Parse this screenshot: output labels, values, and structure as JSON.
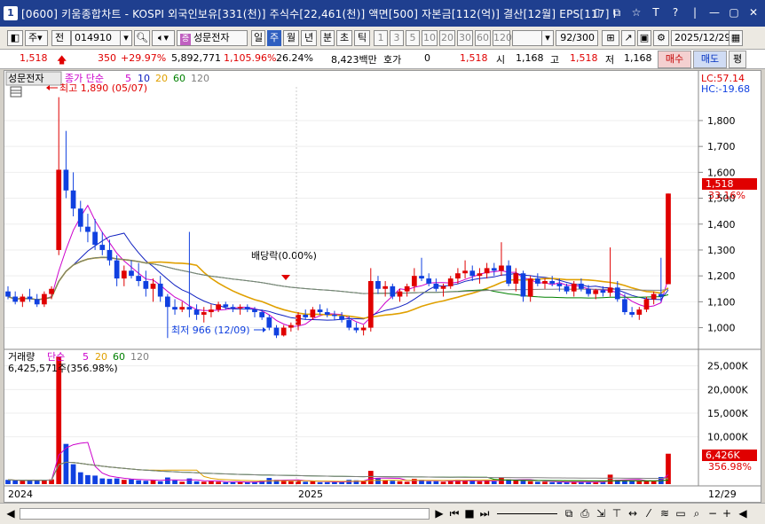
{
  "window": {
    "app_number": "1",
    "title": "[0600] 키움종합차트 - KOSPI 외국인보유[331(천)] 주식수[22,461(천)] 액면[500] 자본금[112(억)] 결산[12월] EPS[117] I",
    "buttons": [
      "▯",
      "⧉",
      "☆",
      "T",
      "?",
      "|",
      "—",
      "▢",
      "✕"
    ]
  },
  "toolbar": {
    "period_label": "주",
    "all_label": "전",
    "code": "014910",
    "stock_name": "성문전자",
    "tabs": [
      "일",
      "주",
      "월",
      "년",
      "분",
      "초",
      "틱"
    ],
    "selected_tab": "주",
    "intervals": [
      "1",
      "3",
      "5",
      "10",
      "20",
      "30",
      "60",
      "120"
    ],
    "count": "92",
    "count_total": "/300",
    "date": "2025/12/29"
  },
  "quote": {
    "price": "1,518",
    "change": "350",
    "change_pct": "+29.97%",
    "volume": "5,892,771",
    "volume_ratio": "1,105.96%",
    "turnover": "26.24%",
    "amount": "8,423백만",
    "hoga_label": "호가",
    "hoga_value": "0",
    "hoga_price": "1,518",
    "open_label": "시",
    "open": "1,168",
    "high_label": "고",
    "high": "1,518",
    "low_label": "저",
    "low": "1,168",
    "buy_label": "매수",
    "sell_label": "매도",
    "extra_label": "평"
  },
  "price_panel": {
    "name_tag": "성문전자",
    "legend_prefix": "종가 단순",
    "legend_periods": [
      "5",
      "10",
      "20",
      "60",
      "120"
    ],
    "legend_colors": [
      "#cc00cc",
      "#1020c0",
      "#e0a000",
      "#008000",
      "#808080"
    ],
    "lc_label": "LC:57.14",
    "hc_label": "HC:-19.68",
    "high_annotation": "최고 1,890 (05/07)",
    "low_annotation": "최저 966 (12/09)",
    "dividend_annotation": "배당락(0.00%)",
    "price_badge": "1,518",
    "pct_badge": "33.16%"
  },
  "volume_panel": {
    "title": "거래량",
    "legend_prefix": "단순",
    "legend_periods": [
      "5",
      "20",
      "60",
      "120"
    ],
    "legend_colors": [
      "#cc00cc",
      "#e0a000",
      "#008000",
      "#808080"
    ],
    "info": "6,425,571주(356.98%)",
    "vol_badge": "6,426K",
    "pct_badge": "356.98%"
  },
  "x_axis": {
    "labels": [
      "2024",
      "2025"
    ],
    "end_label": "12/29"
  },
  "bottom": {
    "buttons": [
      "◀",
      "▶",
      "⏮",
      "■",
      "⏭",
      "−",
      "+",
      "◀"
    ]
  },
  "chart_data": {
    "type": "candlestick",
    "price_axis": {
      "ticks": [
        1000,
        1100,
        1200,
        1300,
        1400,
        1500,
        1600,
        1700,
        1800
      ],
      "min": 930,
      "max": 1930
    },
    "volume_axis": {
      "ticks": [
        10000,
        15000,
        20000,
        25000
      ],
      "unit": "K",
      "max": 27000
    },
    "candles": [
      [
        1140,
        1160,
        1110,
        1120,
        900
      ],
      [
        1120,
        1140,
        1090,
        1100,
        800
      ],
      [
        1100,
        1130,
        1080,
        1120,
        700
      ],
      [
        1120,
        1150,
        1100,
        1110,
        900
      ],
      [
        1110,
        1130,
        1080,
        1090,
        800
      ],
      [
        1090,
        1140,
        1080,
        1130,
        900
      ],
      [
        1130,
        1160,
        1110,
        1150,
        1000
      ],
      [
        1300,
        1890,
        1280,
        1610,
        27000
      ],
      [
        1610,
        1760,
        1500,
        1530,
        8500
      ],
      [
        1530,
        1600,
        1430,
        1460,
        4200
      ],
      [
        1460,
        1490,
        1370,
        1390,
        2500
      ],
      [
        1390,
        1440,
        1330,
        1370,
        1900
      ],
      [
        1370,
        1420,
        1300,
        1320,
        1800
      ],
      [
        1320,
        1370,
        1280,
        1300,
        1200
      ],
      [
        1300,
        1340,
        1240,
        1260,
        1100
      ],
      [
        1260,
        1280,
        1160,
        1190,
        1200
      ],
      [
        1190,
        1240,
        1160,
        1220,
        900
      ],
      [
        1220,
        1260,
        1190,
        1200,
        1000
      ],
      [
        1200,
        1250,
        1160,
        1180,
        800
      ],
      [
        1180,
        1220,
        1120,
        1150,
        700
      ],
      [
        1150,
        1190,
        1100,
        1170,
        900
      ],
      [
        1170,
        1200,
        1100,
        1120,
        600
      ],
      [
        1120,
        1130,
        960,
        1080,
        1400
      ],
      [
        1080,
        1110,
        1050,
        1070,
        800
      ],
      [
        1070,
        1100,
        1060,
        1080,
        500
      ],
      [
        1080,
        1370,
        1040,
        1070,
        1200
      ],
      [
        1070,
        1090,
        1030,
        1050,
        600
      ],
      [
        1050,
        1080,
        1020,
        1060,
        500
      ],
      [
        1060,
        1090,
        1040,
        1070,
        600
      ],
      [
        1070,
        1100,
        1060,
        1090,
        500
      ],
      [
        1090,
        1100,
        1070,
        1080,
        400
      ],
      [
        1080,
        1090,
        1060,
        1075,
        400
      ],
      [
        1075,
        1090,
        1050,
        1080,
        500
      ],
      [
        1080,
        1090,
        1060,
        1070,
        400
      ],
      [
        1070,
        1080,
        1040,
        1060,
        500
      ],
      [
        1060,
        1070,
        1030,
        1040,
        700
      ],
      [
        1040,
        1050,
        990,
        1000,
        1300
      ],
      [
        1000,
        1010,
        960,
        970,
        900
      ],
      [
        970,
        1010,
        966,
        1000,
        800
      ],
      [
        1000,
        1020,
        985,
        1010,
        600
      ],
      [
        1010,
        1060,
        990,
        1050,
        900
      ],
      [
        1050,
        1070,
        1030,
        1040,
        500
      ],
      [
        1040,
        1080,
        1030,
        1070,
        600
      ],
      [
        1070,
        1090,
        1050,
        1060,
        400
      ],
      [
        1060,
        1075,
        1040,
        1050,
        400
      ],
      [
        1050,
        1065,
        1030,
        1045,
        400
      ],
      [
        1045,
        1060,
        1020,
        1030,
        500
      ],
      [
        1030,
        1045,
        990,
        1000,
        900
      ],
      [
        1000,
        1020,
        980,
        990,
        800
      ],
      [
        990,
        1010,
        970,
        1000,
        700
      ],
      [
        1000,
        1230,
        985,
        1180,
        2800
      ],
      [
        1180,
        1200,
        1130,
        1150,
        1200
      ],
      [
        1150,
        1180,
        1120,
        1160,
        800
      ],
      [
        1160,
        1170,
        1110,
        1120,
        700
      ],
      [
        1120,
        1150,
        1100,
        1140,
        600
      ],
      [
        1140,
        1170,
        1120,
        1160,
        500
      ],
      [
        1160,
        1230,
        1140,
        1200,
        1100
      ],
      [
        1200,
        1270,
        1180,
        1190,
        900
      ],
      [
        1190,
        1210,
        1160,
        1170,
        600
      ],
      [
        1170,
        1190,
        1140,
        1150,
        600
      ],
      [
        1150,
        1170,
        1120,
        1160,
        500
      ],
      [
        1160,
        1200,
        1150,
        1190,
        700
      ],
      [
        1190,
        1230,
        1170,
        1210,
        900
      ],
      [
        1210,
        1260,
        1190,
        1220,
        800
      ],
      [
        1220,
        1240,
        1180,
        1200,
        700
      ],
      [
        1200,
        1230,
        1170,
        1210,
        600
      ],
      [
        1210,
        1250,
        1190,
        1230,
        700
      ],
      [
        1230,
        1250,
        1200,
        1220,
        600
      ],
      [
        1220,
        1330,
        1200,
        1240,
        1400
      ],
      [
        1240,
        1260,
        1160,
        1170,
        1000
      ],
      [
        1170,
        1230,
        1140,
        1210,
        800
      ],
      [
        1210,
        1220,
        1100,
        1120,
        900
      ],
      [
        1120,
        1200,
        1100,
        1190,
        600
      ],
      [
        1190,
        1210,
        1160,
        1170,
        500
      ],
      [
        1170,
        1190,
        1150,
        1180,
        500
      ],
      [
        1180,
        1200,
        1160,
        1170,
        400
      ],
      [
        1170,
        1190,
        1140,
        1160,
        400
      ],
      [
        1160,
        1170,
        1130,
        1140,
        400
      ],
      [
        1140,
        1180,
        1120,
        1170,
        500
      ],
      [
        1170,
        1190,
        1140,
        1150,
        500
      ],
      [
        1150,
        1165,
        1120,
        1130,
        400
      ],
      [
        1130,
        1150,
        1110,
        1145,
        400
      ],
      [
        1145,
        1160,
        1120,
        1135,
        400
      ],
      [
        1135,
        1310,
        1120,
        1155,
        2000
      ],
      [
        1155,
        1180,
        1100,
        1110,
        900
      ],
      [
        1110,
        1130,
        1050,
        1060,
        800
      ],
      [
        1060,
        1080,
        1040,
        1050,
        700
      ],
      [
        1050,
        1080,
        1030,
        1070,
        600
      ],
      [
        1070,
        1120,
        1060,
        1110,
        700
      ],
      [
        1110,
        1140,
        1090,
        1130,
        600
      ],
      [
        1130,
        1270,
        1100,
        1120,
        1500
      ],
      [
        1168,
        1518,
        1168,
        1518,
        6426
      ]
    ]
  }
}
